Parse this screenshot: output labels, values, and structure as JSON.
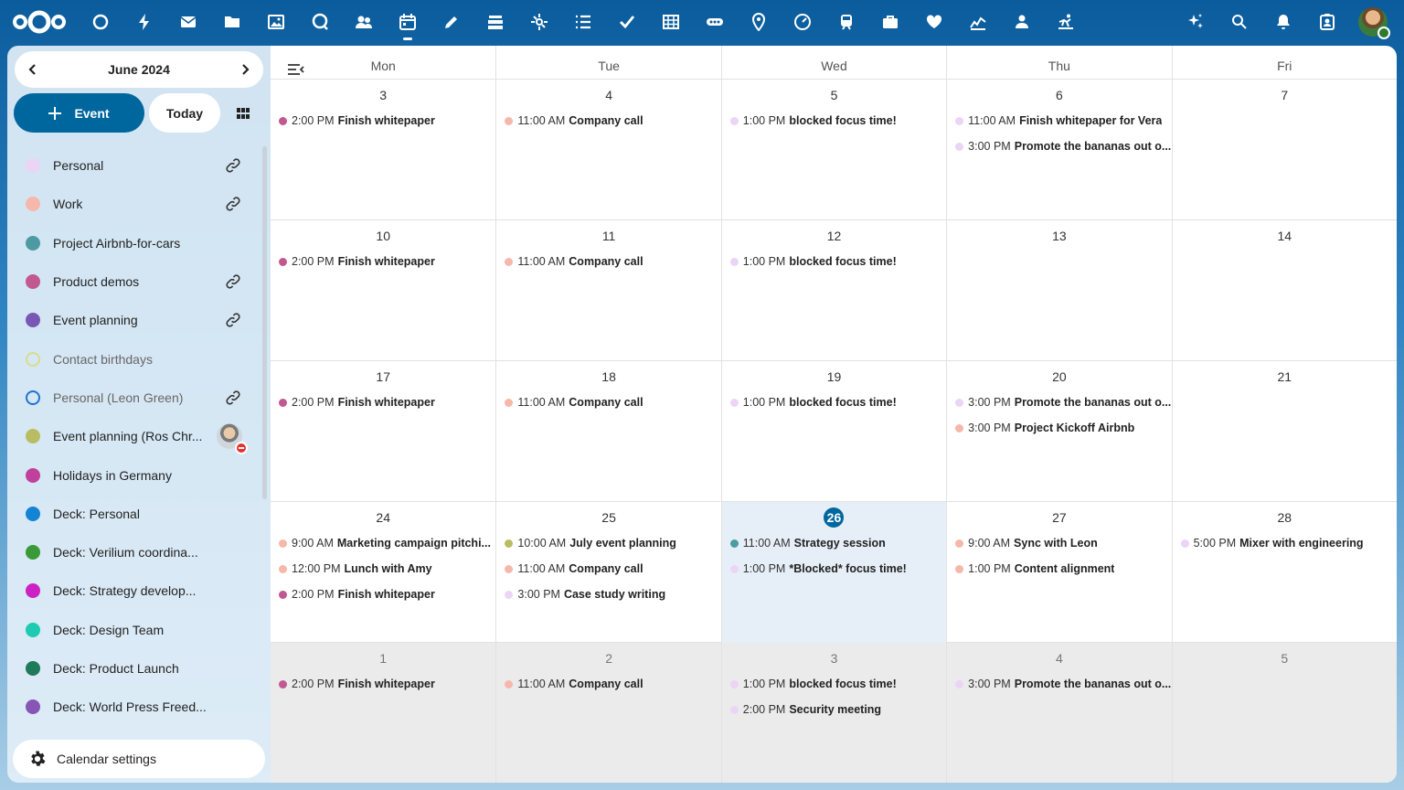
{
  "colors": {
    "personal": "#ead5f7",
    "work": "#f5b8aa",
    "project": "#4e9aa3",
    "product": "#c1588f",
    "event": "#7b57b5",
    "leon": "#1e73d4",
    "ros": "#b8bd62",
    "holidays": "#c0409c",
    "deck_personal": "#1583d4",
    "deck_verilium": "#3a9a3a",
    "deck_strategy": "#cc22c4",
    "deck_design": "#1ccbb0",
    "deck_launch": "#1e7a58",
    "deck_press": "#8855b5",
    "accent": "#00679e"
  },
  "topbar": {
    "apps": [
      {
        "icon": "dashboard-icon"
      },
      {
        "icon": "activity-icon"
      },
      {
        "icon": "mail-icon"
      },
      {
        "icon": "files-icon"
      },
      {
        "icon": "photos-icon"
      },
      {
        "icon": "talk-icon"
      },
      {
        "icon": "contacts-icon"
      },
      {
        "icon": "calendar-icon"
      },
      {
        "icon": "notes-icon"
      },
      {
        "icon": "deck-icon"
      },
      {
        "icon": "collectives-icon"
      },
      {
        "icon": "tasks-icon"
      },
      {
        "icon": "checkmark-icon"
      },
      {
        "icon": "tables-icon"
      },
      {
        "icon": "whiteboard-icon"
      },
      {
        "icon": "maps-icon"
      },
      {
        "icon": "analytics-icon"
      },
      {
        "icon": "transit-icon"
      },
      {
        "icon": "work-icon"
      },
      {
        "icon": "health-icon"
      },
      {
        "icon": "stocks-icon"
      },
      {
        "icon": "user-icon"
      },
      {
        "icon": "sports-icon"
      }
    ],
    "right_icons": [
      "assistant-icon",
      "search-icon",
      "notifications-icon",
      "contacts-menu-icon"
    ]
  },
  "sidebar": {
    "month_label": "June 2024",
    "new_event_label": "Event",
    "today_label": "Today",
    "calendars": [
      {
        "name": "Personal",
        "color": "#ead5f7",
        "link": true
      },
      {
        "name": "Work",
        "color": "#f5b8aa",
        "link": true
      },
      {
        "name": "Project Airbnb-for-cars",
        "color": "#4e9aa3",
        "link": false
      },
      {
        "name": "Product demos",
        "color": "#c1588f",
        "link": true
      },
      {
        "name": "Event planning",
        "color": "#7b57b5",
        "link": true
      },
      {
        "name": "Contact birthdays",
        "color": "#d8dd88",
        "link": false,
        "hollow": true,
        "muted": true
      },
      {
        "name": "Personal (Leon Green)",
        "color": "#1e73d4",
        "link": true,
        "hollow": true,
        "muted": true
      },
      {
        "name": "Event planning (Ros Chr...",
        "color": "#b8bd62",
        "link": false,
        "shared": true
      },
      {
        "name": "Holidays in Germany",
        "color": "#c0409c",
        "link": false
      },
      {
        "name": "Deck: Personal",
        "color": "#1583d4",
        "link": false
      },
      {
        "name": "Deck: Verilium coordina...",
        "color": "#3a9a3a",
        "link": false
      },
      {
        "name": "Deck: Strategy develop...",
        "color": "#cc22c4",
        "link": false
      },
      {
        "name": "Deck: Design Team",
        "color": "#1ccbb0",
        "link": false
      },
      {
        "name": "Deck: Product Launch",
        "color": "#1e7a58",
        "link": false
      },
      {
        "name": "Deck: World Press Freed...",
        "color": "#8855b5",
        "link": false
      }
    ],
    "settings_label": "Calendar settings"
  },
  "calendar": {
    "day_headers": [
      "Mon",
      "Tue",
      "Wed",
      "Thu",
      "Fri"
    ],
    "weeks": [
      [
        {
          "day": "3",
          "events": [
            {
              "time": "2:00 PM",
              "title": "Finish whitepaper",
              "color": "#c1588f"
            }
          ]
        },
        {
          "day": "4",
          "events": [
            {
              "time": "11:00 AM",
              "title": "Company call",
              "color": "#f5b8aa"
            }
          ]
        },
        {
          "day": "5",
          "events": [
            {
              "time": "1:00 PM",
              "title": "blocked focus time!",
              "color": "#ead5f7"
            }
          ]
        },
        {
          "day": "6",
          "events": [
            {
              "time": "11:00 AM",
              "title": "Finish whitepaper for Vera",
              "color": "#ead5f7"
            },
            {
              "time": "3:00 PM",
              "title": "Promote the bananas out o...",
              "color": "#ead5f7"
            }
          ]
        },
        {
          "day": "7",
          "events": []
        }
      ],
      [
        {
          "day": "10",
          "events": [
            {
              "time": "2:00 PM",
              "title": "Finish whitepaper",
              "color": "#c1588f"
            }
          ]
        },
        {
          "day": "11",
          "events": [
            {
              "time": "11:00 AM",
              "title": "Company call",
              "color": "#f5b8aa"
            }
          ]
        },
        {
          "day": "12",
          "events": [
            {
              "time": "1:00 PM",
              "title": "blocked focus time!",
              "color": "#ead5f7"
            }
          ]
        },
        {
          "day": "13",
          "events": []
        },
        {
          "day": "14",
          "events": []
        }
      ],
      [
        {
          "day": "17",
          "events": [
            {
              "time": "2:00 PM",
              "title": "Finish whitepaper",
              "color": "#c1588f"
            }
          ]
        },
        {
          "day": "18",
          "events": [
            {
              "time": "11:00 AM",
              "title": "Company call",
              "color": "#f5b8aa"
            }
          ]
        },
        {
          "day": "19",
          "events": [
            {
              "time": "1:00 PM",
              "title": "blocked focus time!",
              "color": "#ead5f7"
            }
          ]
        },
        {
          "day": "20",
          "events": [
            {
              "time": "3:00 PM",
              "title": "Promote the bananas out o...",
              "color": "#ead5f7"
            },
            {
              "time": "3:00 PM",
              "title": "Project Kickoff Airbnb",
              "color": "#f5b8aa"
            }
          ]
        },
        {
          "day": "21",
          "events": []
        }
      ],
      [
        {
          "day": "24",
          "events": [
            {
              "time": "9:00 AM",
              "title": "Marketing campaign pitchi...",
              "color": "#f5b8aa"
            },
            {
              "time": "12:00 PM",
              "title": "Lunch with Amy",
              "color": "#f5b8aa"
            },
            {
              "time": "2:00 PM",
              "title": "Finish whitepaper",
              "color": "#c1588f"
            }
          ]
        },
        {
          "day": "25",
          "events": [
            {
              "time": "10:00 AM",
              "title": "July event planning",
              "color": "#b8bd62"
            },
            {
              "time": "11:00 AM",
              "title": "Company call",
              "color": "#f5b8aa"
            },
            {
              "time": "3:00 PM",
              "title": "Case study writing",
              "color": "#ead5f7"
            }
          ]
        },
        {
          "day": "26",
          "today": true,
          "events": [
            {
              "time": "11:00 AM",
              "title": "Strategy session",
              "color": "#4e9aa3"
            },
            {
              "time": "1:00 PM",
              "title": "*Blocked* focus time!",
              "color": "#ead5f7"
            }
          ]
        },
        {
          "day": "27",
          "events": [
            {
              "time": "9:00 AM",
              "title": "Sync with Leon",
              "color": "#f5b8aa"
            },
            {
              "time": "1:00 PM",
              "title": "Content alignment",
              "color": "#f5b8aa"
            }
          ]
        },
        {
          "day": "28",
          "events": [
            {
              "time": "5:00 PM",
              "title": "Mixer with engineering",
              "color": "#ead5f7"
            }
          ]
        }
      ],
      [
        {
          "day": "1",
          "other": true,
          "events": [
            {
              "time": "2:00 PM",
              "title": "Finish whitepaper",
              "color": "#c1588f"
            }
          ]
        },
        {
          "day": "2",
          "other": true,
          "events": [
            {
              "time": "11:00 AM",
              "title": "Company call",
              "color": "#f5b8aa"
            }
          ]
        },
        {
          "day": "3",
          "other": true,
          "events": [
            {
              "time": "1:00 PM",
              "title": "blocked focus time!",
              "color": "#ead5f7"
            },
            {
              "time": "2:00 PM",
              "title": "Security meeting",
              "color": "#ead5f7"
            }
          ]
        },
        {
          "day": "4",
          "other": true,
          "events": [
            {
              "time": "3:00 PM",
              "title": "Promote the bananas out o...",
              "color": "#ead5f7"
            }
          ]
        },
        {
          "day": "5",
          "other": true,
          "events": []
        }
      ]
    ]
  }
}
